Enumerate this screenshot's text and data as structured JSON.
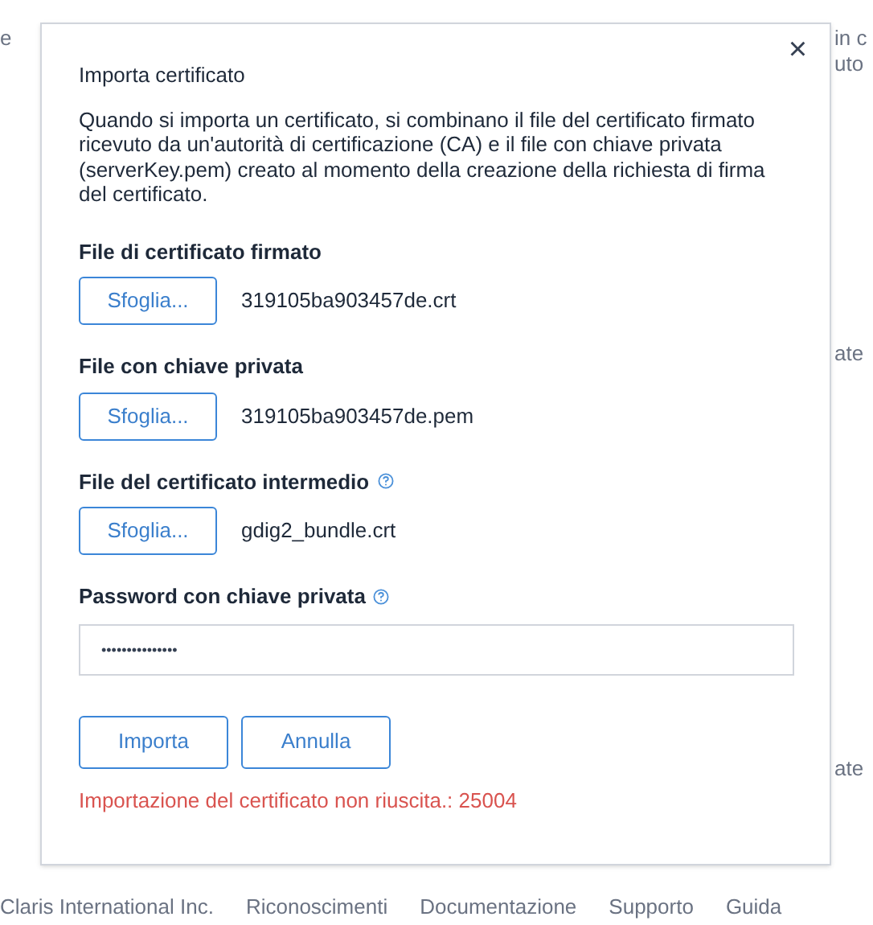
{
  "background": {
    "left_fragments": [
      "e"
    ],
    "right_fragments": [
      "in c",
      "uto",
      "ate",
      "ate"
    ],
    "footer": [
      "Claris International Inc.",
      "Riconoscimenti",
      "Documentazione",
      "Supporto",
      "Guida"
    ]
  },
  "dialog": {
    "title": "Importa certificato",
    "close": "×",
    "description": "Quando si importa un certificato, si combinano il file del certificato firmato ricevuto da un'autorità di certificazione (CA) e il file con chiave privata (serverKey.pem) creato al momento della creazione della richiesta di firma del certificato.",
    "fields": [
      {
        "kind": "file",
        "label": "File di certificato firmato",
        "help": false,
        "button": "Sfoglia...",
        "file": "319105ba903457de.crt"
      },
      {
        "kind": "file",
        "label": "File con chiave privata",
        "help": false,
        "button": "Sfoglia...",
        "file": "319105ba903457de.pem"
      },
      {
        "kind": "file",
        "label": "File del certificato intermedio",
        "help": true,
        "button": "Sfoglia...",
        "file": "gdig2_bundle.crt"
      },
      {
        "kind": "password",
        "label": "Password con chiave privata",
        "help": true,
        "value": "•••••••••••••••"
      }
    ],
    "buttons": [
      "Importa",
      "Annulla"
    ],
    "error": "Importazione del certificato non riuscita.: 25004"
  }
}
